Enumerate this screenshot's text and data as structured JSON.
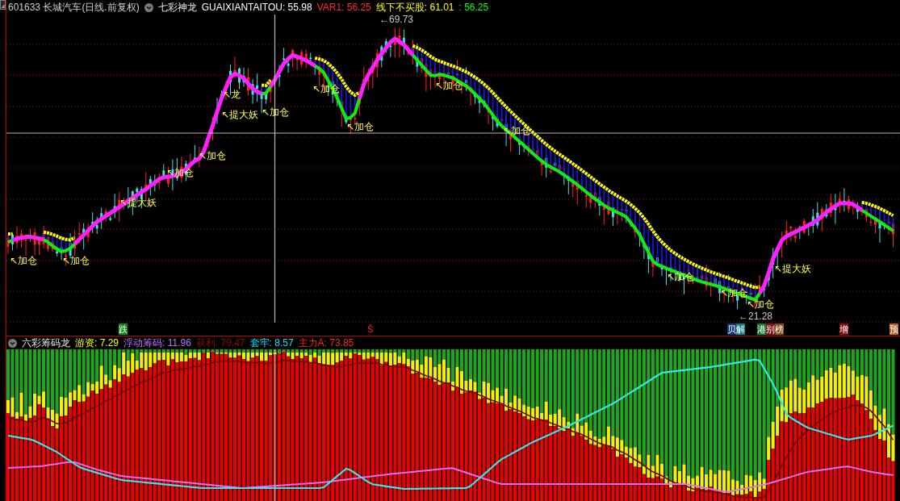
{
  "main_header": {
    "symbol": "601633 长城汽车(日线.前复权)",
    "indicator": "七彩神龙",
    "values": [
      {
        "text": "GUAIXIANTAITOU: 55.98",
        "color": "#ffffff"
      },
      {
        "text": "VAR1: 56.25",
        "color": "#ff2a2a"
      },
      {
        "text": "线下不买股: 61.01",
        "color": "#ffff00"
      },
      {
        "text": ": 56.25",
        "color": "#00ff00"
      }
    ]
  },
  "main_chart": {
    "annotations": [
      {
        "text": "↖加仓"
      },
      {
        "text": "↖加仓"
      },
      {
        "text": "↖提大妖"
      },
      {
        "text": "↖加仓"
      },
      {
        "text": "↖加仓"
      },
      {
        "text": "↖龙"
      },
      {
        "text": "↖提大妖"
      },
      {
        "text": "↖加仓"
      },
      {
        "text": "↖加仓"
      },
      {
        "text": "↖加仓"
      },
      {
        "text": "↖加仓"
      },
      {
        "text": "↖加仓"
      },
      {
        "text": "↖加仓"
      },
      {
        "text": "↖加仓"
      },
      {
        "text": "↖加仓"
      },
      {
        "text": "↖提大妖"
      }
    ],
    "price_labels": [
      {
        "text": "←69.73"
      },
      {
        "text": "←21.28"
      }
    ]
  },
  "signal_row": [
    {
      "text": "跌",
      "kind": "badge",
      "color": "#128a12"
    },
    {
      "text": "Ŝ",
      "kind": "mark",
      "color": "#ff2020"
    },
    {
      "text": "贝",
      "kind": "badge",
      "color": "#123c78"
    },
    {
      "text": "解",
      "kind": "badge",
      "color": "#0c8484"
    },
    {
      "text": "港",
      "kind": "badge",
      "color": "#127a30"
    },
    {
      "text": "别",
      "kind": "badge",
      "color": "#8a1010"
    },
    {
      "text": "榜",
      "kind": "badge",
      "color": "#8a4a10"
    },
    {
      "text": "增",
      "kind": "badge",
      "color": "#8a0c0c"
    },
    {
      "text": "预",
      "kind": "badge",
      "color": "#c0601a"
    }
  ],
  "lower_header": {
    "indicator": "六彩筹码龙",
    "values": [
      {
        "text": "游资: 7.29",
        "color": "#ffff00"
      },
      {
        "text": "浮动筹码: 11.96",
        "color": "#c070ff"
      },
      {
        "text": "获利: 79.47",
        "color": "#8b0a0a"
      },
      {
        "text": "套牢: 8.57",
        "color": "#00e0ff"
      },
      {
        "text": "主力A: 73.85",
        "color": "#ff2020"
      }
    ]
  }
}
